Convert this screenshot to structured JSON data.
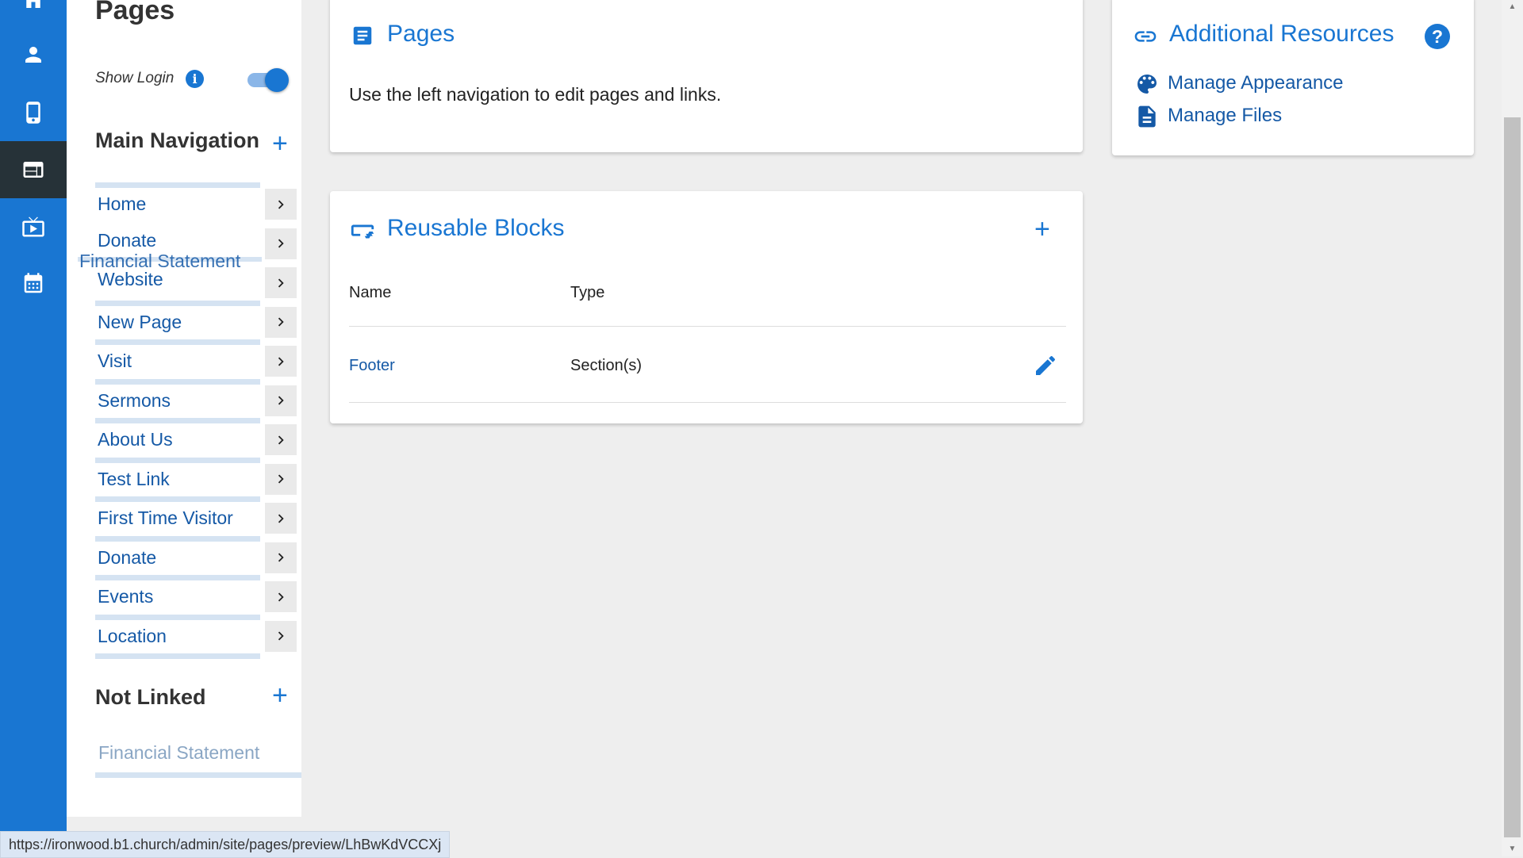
{
  "sidebar": {
    "title": "Pages",
    "show_login_label": "Show Login",
    "info_glyph": "i",
    "main_nav_heading": "Main Navigation",
    "plus_glyph": "+",
    "nav_items": [
      {
        "label": "Home"
      },
      {
        "label": "Donate"
      },
      {
        "label": "Website"
      },
      {
        "label": "New Page"
      },
      {
        "label": "Visit"
      },
      {
        "label": "Sermons"
      },
      {
        "label": "About Us"
      },
      {
        "label": "Test Link"
      },
      {
        "label": "First Time Visitor"
      },
      {
        "label": "Donate"
      },
      {
        "label": "Events"
      },
      {
        "label": "Location"
      }
    ],
    "dragging_label": "Financial Statement",
    "not_linked_heading": "Not Linked",
    "not_linked_items": [
      {
        "label": "Financial Statement"
      }
    ]
  },
  "pages_card": {
    "title": "Pages",
    "description": "Use the left navigation to edit pages and links."
  },
  "blocks_card": {
    "title": "Reusable Blocks",
    "col_name": "Name",
    "col_type": "Type",
    "rows": [
      {
        "name": "Footer",
        "type": "Section(s)"
      }
    ]
  },
  "resources_card": {
    "title": "Additional Resources",
    "help_glyph": "?",
    "links": [
      {
        "label": "Manage Appearance",
        "icon": "palette-icon"
      },
      {
        "label": "Manage Files",
        "icon": "file-icon"
      }
    ]
  },
  "status_bar": {
    "url": "https://ironwood.b1.church/admin/site/pages/preview/LhBwKdVCCXj"
  },
  "colors": {
    "primary": "#1976d2",
    "rail_active": "#263238",
    "link": "#1559a6",
    "nav_bar": "#d5e3f2",
    "background": "#eeeeee"
  }
}
